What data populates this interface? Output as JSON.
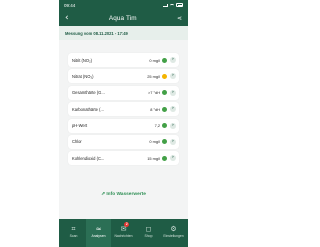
{
  "status": {
    "time": "09:44"
  },
  "header": {
    "title": "Aqua Tim"
  },
  "measurement": {
    "label": "Messung vom 08.11.2021 - 17:49"
  },
  "rows": [
    {
      "name": "Nitrit (NO₂)",
      "value": "0 mg/l",
      "status": "green",
      "color": "#43a047"
    },
    {
      "name": "Nitrat (NO₃)",
      "value": "25 mg/l",
      "status": "yellow",
      "color": "#f4b400"
    },
    {
      "name": "Gesamthärte (G...",
      "value": ">7 °dH",
      "status": "green",
      "color": "#43a047"
    },
    {
      "name": "Karbonathärte (...",
      "value": "8 °dH",
      "status": "green",
      "color": "#43a047"
    },
    {
      "name": "pH-Wert",
      "value": "7,2",
      "status": "green",
      "color": "#43a047"
    },
    {
      "name": "Chlor",
      "value": "0 mg/l",
      "status": "green",
      "color": "#43a047"
    },
    {
      "name": "Kohlendioxid (C...",
      "value": "15 mg/l",
      "status": "green",
      "color": "#43a047"
    }
  ],
  "info_link": {
    "label": "Info Wasserwerte"
  },
  "tabs": [
    {
      "label": "Scan",
      "icon": "scan-icon"
    },
    {
      "label": "Analysen",
      "icon": "waves-icon"
    },
    {
      "label": "Nachrichten",
      "icon": "message-icon",
      "badge": "2"
    },
    {
      "label": "Shop",
      "icon": "bag-icon"
    },
    {
      "label": "Einstellungen",
      "icon": "gear-icon"
    }
  ],
  "colors": {
    "primary": "#1f5c45",
    "accent": "#2f8f55",
    "warning": "#f4b400",
    "ok": "#43a047",
    "badge": "#e53935"
  }
}
